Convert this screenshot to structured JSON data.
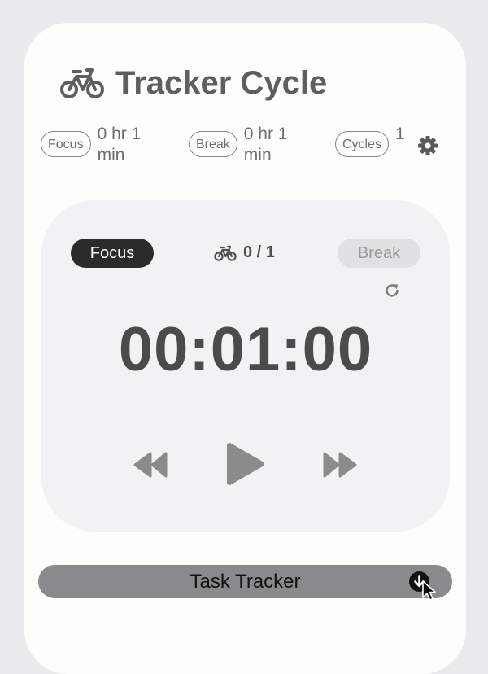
{
  "app": {
    "title": "Tracker Cycle",
    "icon": "bicycle-icon"
  },
  "stats": [
    {
      "label": "Focus",
      "value": "0 hr 1 min"
    },
    {
      "label": "Break",
      "value": "0 hr 1 min"
    },
    {
      "label": "Cycles",
      "value": "1"
    }
  ],
  "settings": {
    "icon": "gear-icon"
  },
  "timer": {
    "modes": {
      "focus": "Focus",
      "break": "Break",
      "active": "Focus"
    },
    "cycle_progress": "0 / 1",
    "time": "00:01:00",
    "reset_icon": "reset-icon"
  },
  "controls": {
    "rewind_icon": "rewind-icon",
    "play_icon": "play-icon",
    "forward_icon": "fast-forward-icon"
  },
  "task_tracker": {
    "label": "Task Tracker",
    "icon": "chevron-down-circle-icon"
  },
  "colors": {
    "panel": "#f2f1f3",
    "active_mode": "#2b2b2c",
    "task_bar": "#8a898c",
    "text": "#4b4b4c"
  }
}
